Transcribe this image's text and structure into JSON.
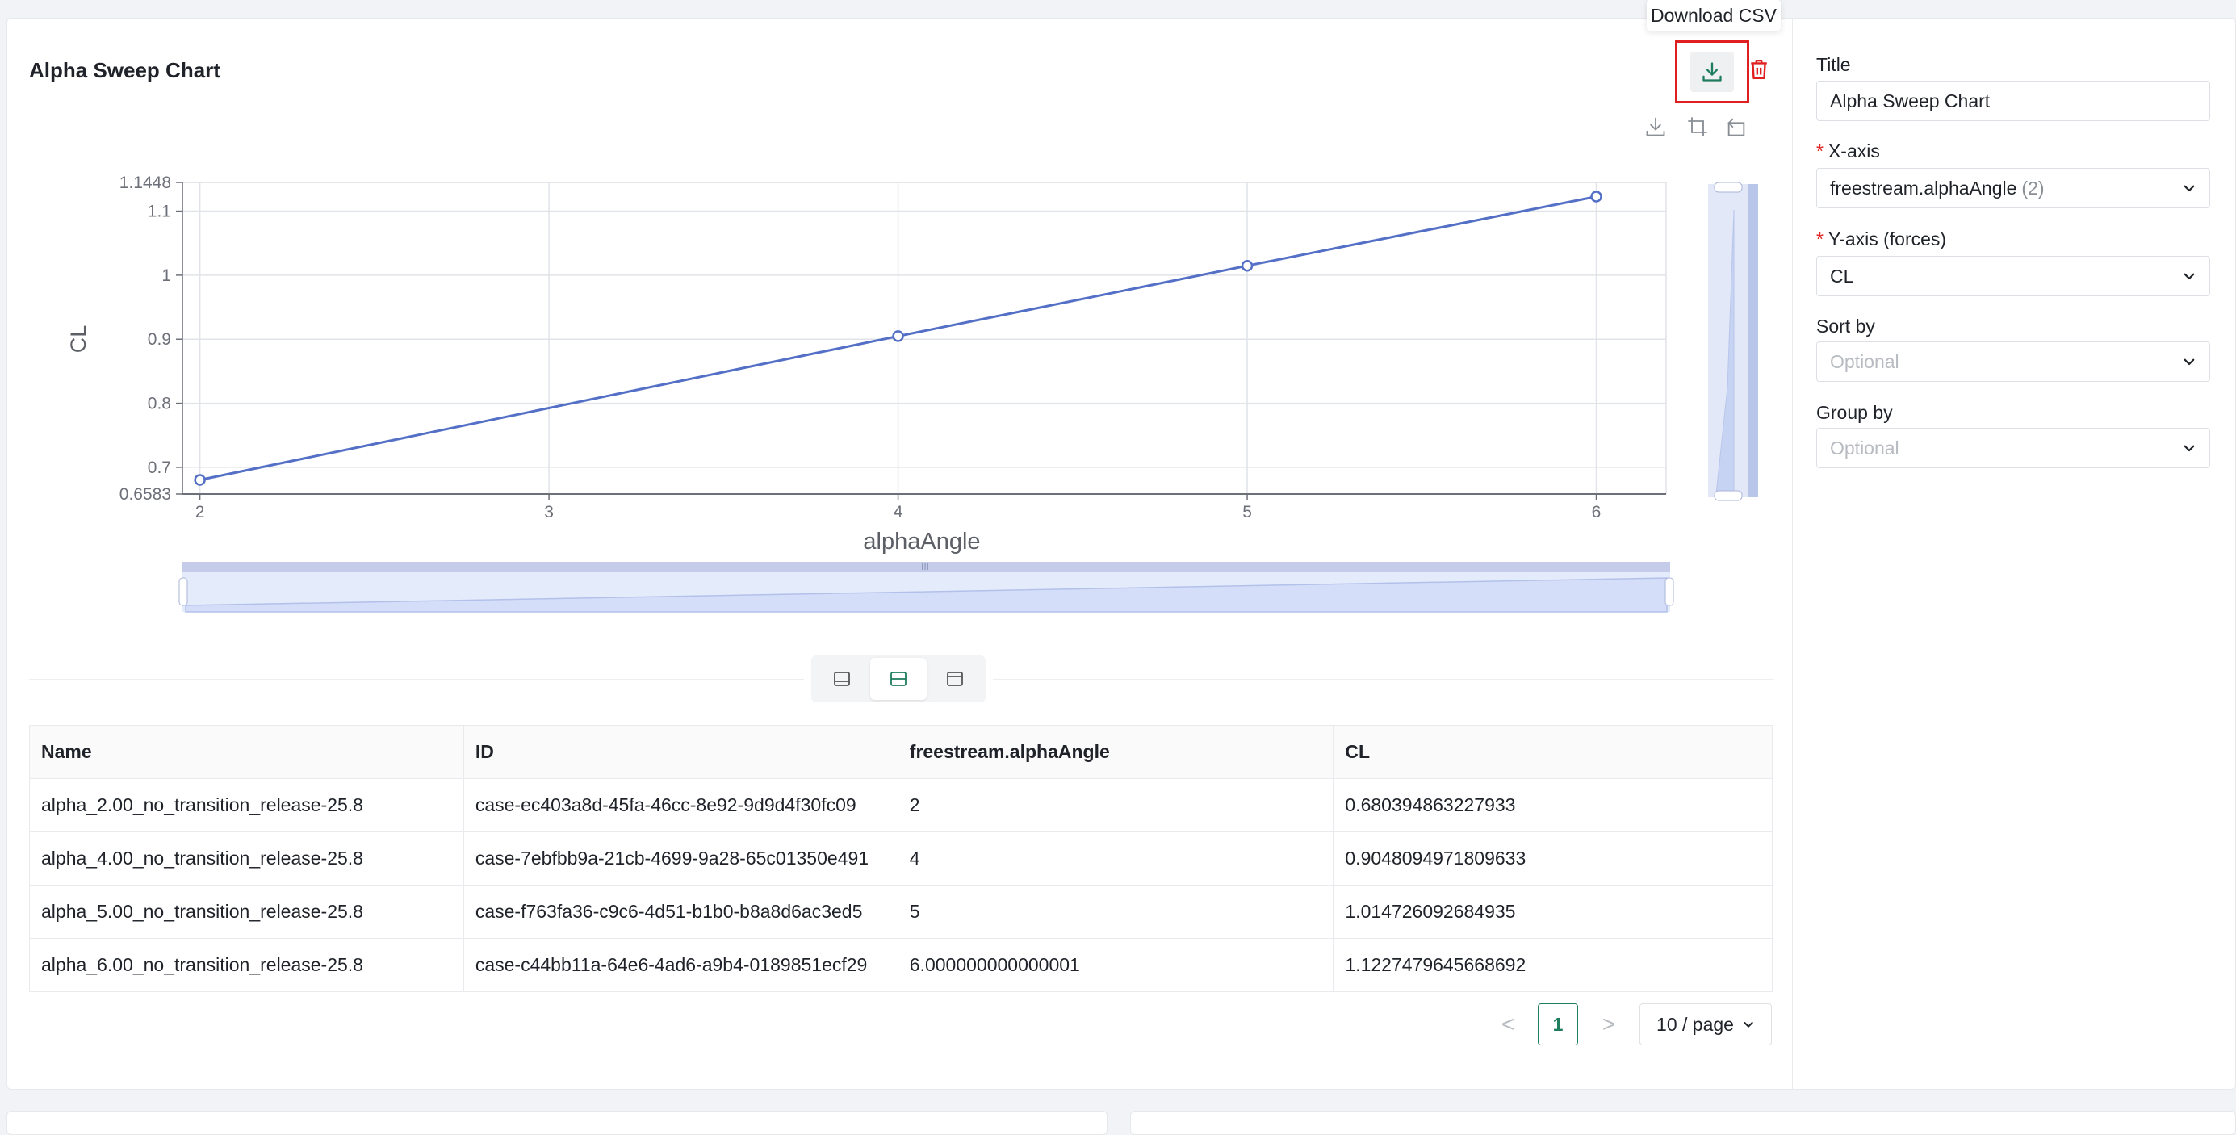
{
  "card": {
    "title": "Alpha Sweep Chart",
    "tooltip": "Download CSV",
    "accent_color": "#1e7d5c",
    "danger_color": "#e02020"
  },
  "chart_toolbar": {
    "icons": [
      "download-image-icon",
      "zoom-select-icon",
      "zoom-reset-icon"
    ]
  },
  "chart_data": {
    "type": "line",
    "xlabel": "alphaAngle",
    "ylabel": "CL",
    "x": [
      2,
      4,
      5,
      6
    ],
    "y": [
      0.680394863227933,
      0.9048094971809633,
      1.014726092684935,
      1.1227479645668692
    ],
    "xlim": [
      1.95,
      6.2
    ],
    "ylim": [
      0.6583,
      1.1448
    ],
    "x_ticks": [
      "2",
      "3",
      "4",
      "5",
      "6"
    ],
    "y_ticks": [
      "0.6583",
      "0.7",
      "0.8",
      "0.9",
      "1",
      "1.1",
      "1.1448"
    ],
    "grid": true,
    "line_color": "#5470c6"
  },
  "view_toggle": {
    "options": [
      "chart-only-icon",
      "split-icon",
      "table-only-icon"
    ],
    "active_index": 1
  },
  "table": {
    "columns": [
      "Name",
      "ID",
      "freestream.alphaAngle",
      "CL"
    ],
    "rows": [
      [
        "alpha_2.00_no_transition_release-25.8",
        "case-ec403a8d-45fa-46cc-8e92-9d9d4f30fc09",
        "2",
        "0.680394863227933"
      ],
      [
        "alpha_4.00_no_transition_release-25.8",
        "case-7ebfbb9a-21cb-4699-9a28-65c01350e491",
        "4",
        "0.9048094971809633"
      ],
      [
        "alpha_5.00_no_transition_release-25.8",
        "case-f763fa36-c9c6-4d51-b1b0-b8a8d6ac3ed5",
        "5",
        "1.014726092684935"
      ],
      [
        "alpha_6.00_no_transition_release-25.8",
        "case-c44bb11a-64e6-4ad6-a9b4-0189851ecf29",
        "6.000000000000001",
        "1.1227479645668692"
      ]
    ]
  },
  "pagination": {
    "prev": "<",
    "next": ">",
    "current_page": "1",
    "page_size": "10 / page"
  },
  "form": {
    "title_label": "Title",
    "title_value": "Alpha Sweep Chart",
    "x_axis_label": "X-axis",
    "x_axis_value": "freestream.alphaAngle",
    "x_axis_count": "(2)",
    "y_axis_label": "Y-axis (forces)",
    "y_axis_value": "CL",
    "sort_label": "Sort by",
    "sort_placeholder": "Optional",
    "group_label": "Group by",
    "group_placeholder": "Optional",
    "required_mark": "*"
  }
}
